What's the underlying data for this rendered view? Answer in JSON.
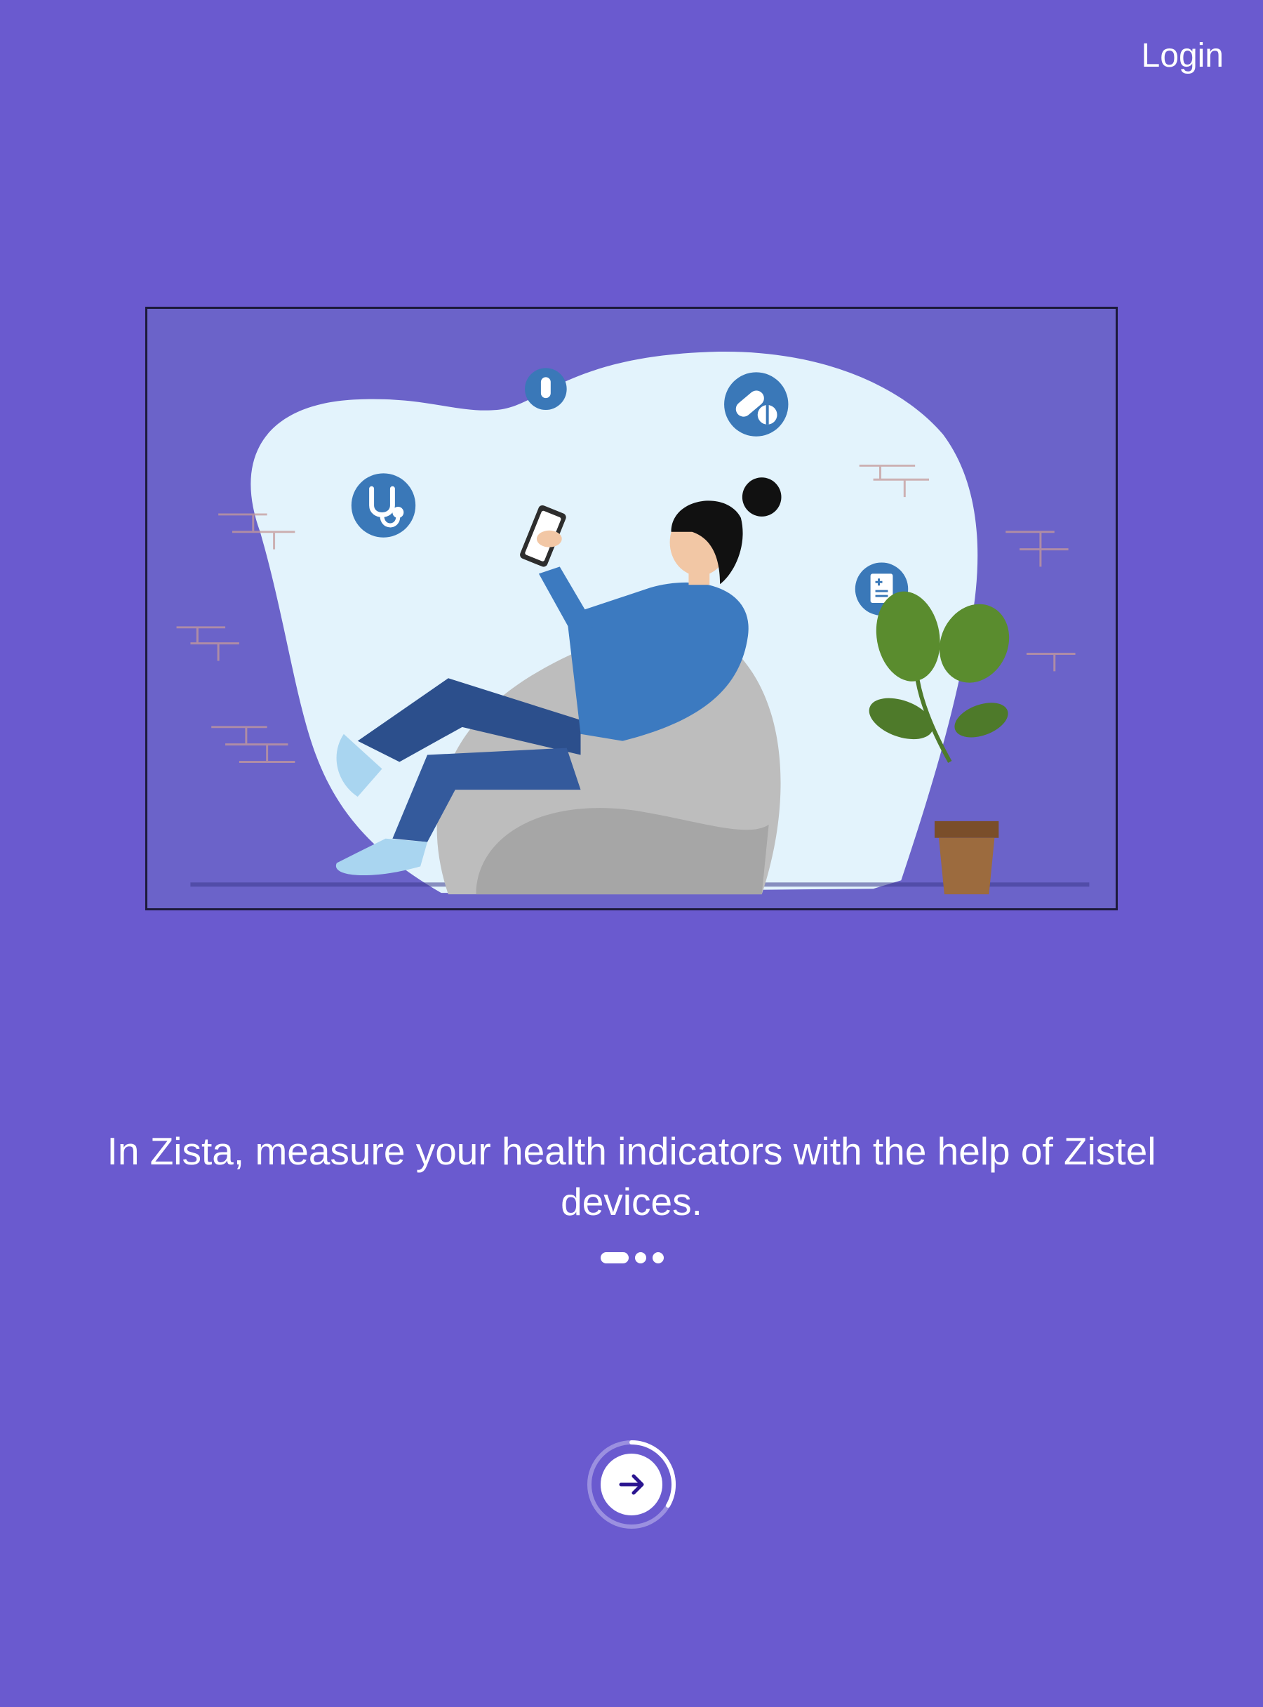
{
  "header": {
    "login_label": "Login"
  },
  "onboarding": {
    "caption": "In Zista, measure your health indicators with the help of Zistel devices.",
    "page_count": 3,
    "current_page": 1,
    "progress_fraction": 0.33
  },
  "icons": {
    "next": "arrow-right-icon",
    "stethoscope": "stethoscope-icon",
    "test_tube": "test-tube-icon",
    "pills": "pills-icon",
    "document": "medical-document-icon"
  },
  "colors": {
    "background": "#6a5acf",
    "accent_dark": "#2a1590",
    "icon_blue": "#3a78b8",
    "blob": "#e3f3fc"
  }
}
